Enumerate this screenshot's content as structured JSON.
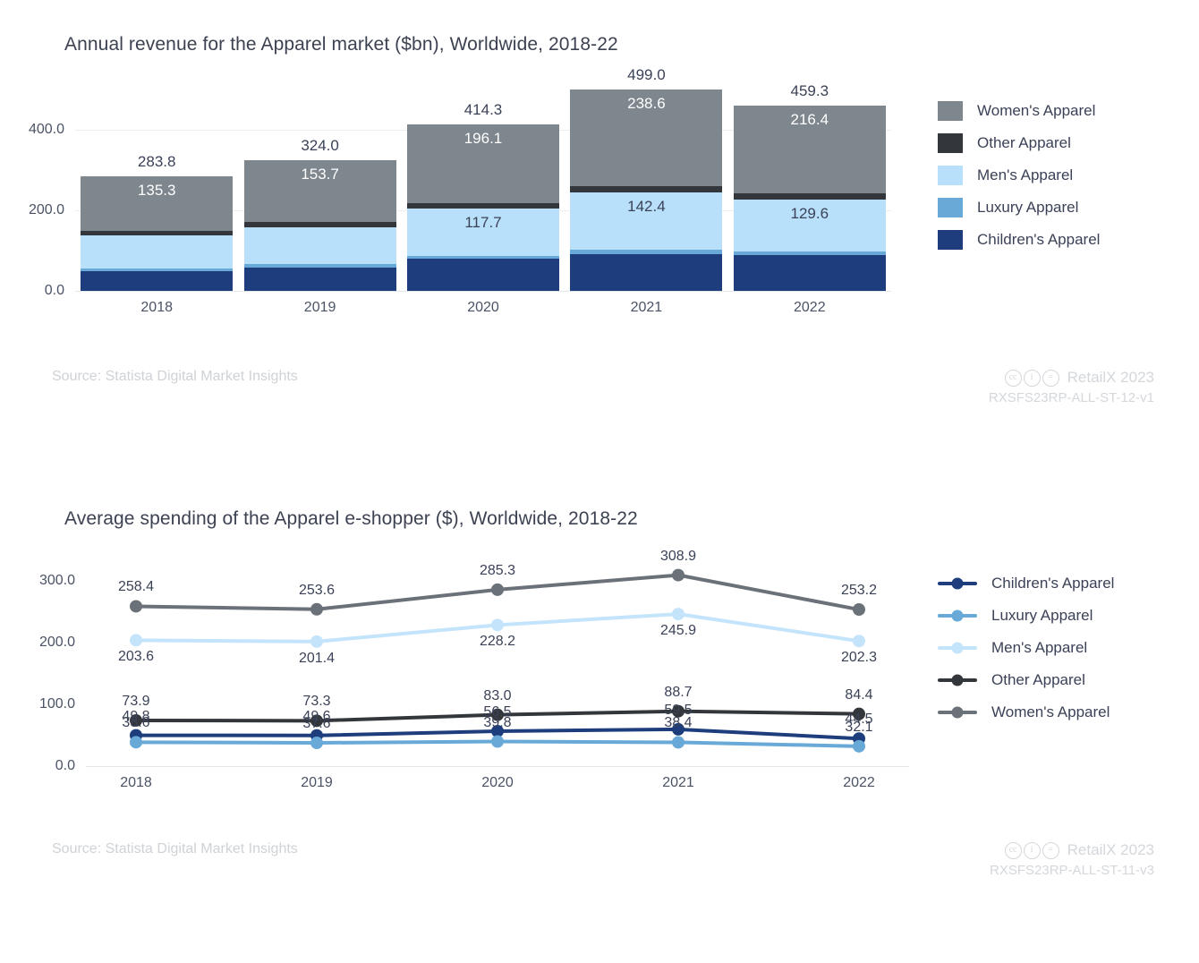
{
  "panels": {
    "revenue": {
      "title": "Annual revenue for the Apparel market ($bn), Worldwide, 2018-22",
      "source": "Source: Statista Digital Market Insights",
      "attribution": "RetailX 2023",
      "code": "RXSFS23RP-ALL-ST-12-v1"
    },
    "spending": {
      "title": "Average spending of the Apparel e-shopper ($), Worldwide, 2018-22",
      "source": "Source: Statista Digital Market Insights",
      "attribution": "RetailX 2023",
      "code": "RXSFS23RP-ALL-ST-11-v3"
    }
  },
  "colors": {
    "womens": "#7e868e",
    "other": "#33373b",
    "mens": "#b9e0fa",
    "luxury": "#68a9d8",
    "childrens": "#1d3d7c",
    "text": "#3b4257",
    "muted": "#cfd2d6"
  },
  "chart_data": [
    {
      "type": "bar",
      "stacked": true,
      "title": "Annual revenue for the Apparel market ($bn), Worldwide, 2018-22",
      "xlabel": "",
      "ylabel": "",
      "ylim": [
        0,
        500
      ],
      "yticks": [
        "0.0",
        "200.0",
        "400.0"
      ],
      "ytick_values": [
        0,
        200,
        400
      ],
      "grid": true,
      "legend_position": "right",
      "categories": [
        "2018",
        "2019",
        "2020",
        "2021",
        "2022"
      ],
      "totals": [
        283.8,
        324.0,
        414.3,
        499.0,
        459.3
      ],
      "total_labels": [
        "283.8",
        "324.0",
        "414.3",
        "499.0",
        "459.3"
      ],
      "series": [
        {
          "name": "Women's Apparel",
          "color": "#7e868e",
          "values": [
            135.3,
            153.7,
            196.1,
            238.6,
            216.4
          ],
          "labels": [
            "135.3",
            "153.7",
            "196.1",
            "238.6",
            "216.4"
          ],
          "show_labels": true
        },
        {
          "name": "Other Apparel",
          "color": "#33373b",
          "values": [
            11.0,
            11.5,
            13.0,
            16.5,
            15.5
          ],
          "labels": [
            "",
            "",
            "",
            "",
            ""
          ],
          "show_labels": false
        },
        {
          "name": "Men's Apparel",
          "color": "#b9e0fa",
          "values": [
            82.0,
            93.0,
            117.7,
            142.4,
            129.6
          ],
          "labels": [
            "",
            "",
            "117.7",
            "142.4",
            "129.6"
          ],
          "show_labels": true
        },
        {
          "name": "Luxury Apparel",
          "color": "#68a9d8",
          "values": [
            6.5,
            7.0,
            8.5,
            10.5,
            9.8
          ],
          "labels": [
            "",
            "",
            "",
            "",
            ""
          ],
          "show_labels": false
        },
        {
          "name": "Children's Apparel",
          "color": "#1d3d7c",
          "values": [
            49.0,
            58.8,
            79.0,
            91.0,
            88.0
          ],
          "labels": [
            "",
            "",
            "",
            "",
            ""
          ],
          "show_labels": false
        }
      ],
      "stack_order_bottom_to_top": [
        "Children's Apparel",
        "Luxury Apparel",
        "Men's Apparel",
        "Other Apparel",
        "Women's Apparel"
      ],
      "legend": [
        {
          "label": "Women's Apparel",
          "color": "#7e868e"
        },
        {
          "label": "Other Apparel",
          "color": "#33373b"
        },
        {
          "label": "Men's Apparel",
          "color": "#b9e0fa"
        },
        {
          "label": "Luxury Apparel",
          "color": "#68a9d8"
        },
        {
          "label": "Children's Apparel",
          "color": "#1d3d7c"
        }
      ]
    },
    {
      "type": "line",
      "title": "Average spending of the Apparel e-shopper ($), Worldwide, 2018-22",
      "xlabel": "",
      "ylabel": "",
      "ylim": [
        0,
        330
      ],
      "yticks": [
        "0.0",
        "100.0",
        "200.0",
        "300.0"
      ],
      "ytick_values": [
        0,
        100,
        200,
        300
      ],
      "grid": false,
      "legend_position": "right",
      "x": [
        "2018",
        "2019",
        "2020",
        "2021",
        "2022"
      ],
      "series": [
        {
          "name": "Women's Apparel",
          "color": "#6b7178",
          "values": [
            258.4,
            253.6,
            285.3,
            308.9,
            253.2
          ],
          "labels": [
            "258.4",
            "253.6",
            "285.3",
            "308.9",
            "253.2"
          ],
          "label_pos": [
            "above",
            "above",
            "above",
            "above",
            "above"
          ]
        },
        {
          "name": "Men's Apparel",
          "color": "#c4e4fb",
          "values": [
            203.6,
            201.4,
            228.2,
            245.9,
            202.3
          ],
          "labels": [
            "203.6",
            "201.4",
            "228.2",
            "245.9",
            "202.3"
          ],
          "label_pos": [
            "below",
            "below",
            "below",
            "below",
            "below"
          ]
        },
        {
          "name": "Other Apparel",
          "color": "#33373b",
          "values": [
            73.9,
            73.3,
            83.0,
            88.7,
            84.4
          ],
          "labels": [
            "73.9",
            "73.3",
            "83.0",
            "88.7",
            "84.4"
          ],
          "label_pos": [
            "above",
            "above",
            "above",
            "above",
            "above"
          ]
        },
        {
          "name": "Children's Apparel",
          "color": "#1d3d7c",
          "values": [
            49.8,
            49.6,
            56.5,
            59.5,
            44.5
          ],
          "labels": [
            "49.8",
            "49.6",
            "56.5",
            "59.5",
            "44.5"
          ],
          "label_pos": [
            "above",
            "above",
            "above",
            "above",
            "above"
          ]
        },
        {
          "name": "Luxury Apparel",
          "color": "#68a9d8",
          "values": [
            38.6,
            37.6,
            39.8,
            38.4,
            32.1
          ],
          "labels": [
            "38.6",
            "37.6",
            "39.8",
            "38.4",
            "32.1"
          ],
          "label_pos": [
            "above",
            "above",
            "above",
            "above",
            "above"
          ]
        }
      ],
      "legend": [
        {
          "label": "Children's Apparel",
          "color": "#1d3d7c"
        },
        {
          "label": "Luxury Apparel",
          "color": "#68a9d8"
        },
        {
          "label": "Men's Apparel",
          "color": "#c4e4fb"
        },
        {
          "label": "Other Apparel",
          "color": "#33373b"
        },
        {
          "label": "Women's Apparel",
          "color": "#6b7178"
        }
      ]
    }
  ]
}
